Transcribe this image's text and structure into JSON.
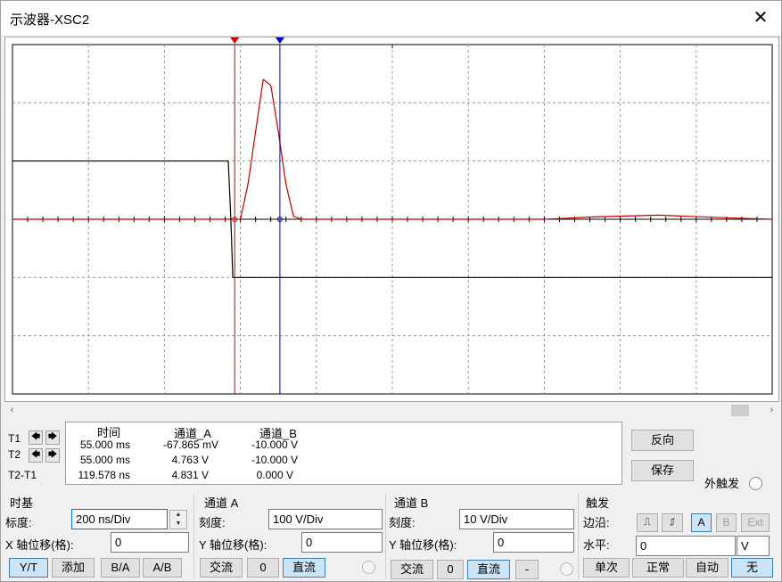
{
  "window": {
    "title": "示波器-XSC2",
    "close_glyph": "✕"
  },
  "cursors": {
    "rows": [
      {
        "label": "T1",
        "time": "55.000 ms",
        "cha": "-67.865 mV",
        "chb": "-10.000 V"
      },
      {
        "label": "T2",
        "time": "55.000 ms",
        "cha": "4.763 V",
        "chb": "-10.000 V"
      },
      {
        "label": "T2-T1",
        "time": "119.578 ns",
        "cha": "4.831 V",
        "chb": "0.000 V"
      }
    ],
    "headers": {
      "time": "时间",
      "cha": "通道_A",
      "chb": "通道_B"
    },
    "left_glyph": "🡄",
    "right_glyph": "🡆"
  },
  "side_buttons": {
    "reverse": "反向",
    "save": "保存",
    "ext_trigger": "外触发"
  },
  "timebase": {
    "title": "时基",
    "scale_label": "标度:",
    "scale_value": "200 ns/Div",
    "xpos_label": "X 轴位移(格):",
    "xpos_value": "0",
    "buttons": [
      "Y/T",
      "添加",
      "B/A",
      "A/B"
    ],
    "selected": "Y/T"
  },
  "channel_a": {
    "title": "通道 A",
    "scale_label": "刻度:",
    "scale_value": "100  V/Div",
    "ypos_label": "Y 轴位移(格):",
    "ypos_value": "0",
    "coupling": [
      "交流",
      "0",
      "直流"
    ],
    "selected": "直流"
  },
  "channel_b": {
    "title": "通道 B",
    "scale_label": "刻度:",
    "scale_value": "10  V/Div",
    "ypos_label": "Y 轴位移(格):",
    "ypos_value": "0",
    "coupling": [
      "交流",
      "0",
      "直流",
      "-"
    ],
    "selected": "直流"
  },
  "trigger": {
    "title": "触发",
    "edge_label": "边沿:",
    "edge_buttons": [
      "⎍",
      "⎎",
      "A",
      "B",
      "Ext"
    ],
    "source_selected": "A",
    "level_label": "水平:",
    "level_value": "0",
    "level_unit": "V",
    "modes": [
      "单次",
      "正常",
      "自动",
      "无"
    ],
    "mode_selected": "无"
  },
  "colors": {
    "channel_a_trace": "#c00000",
    "channel_b_trace": "#000000",
    "cursor_t1": "#d40000",
    "cursor_t2": "#0000c0",
    "grid": "#9a9a9a",
    "selected_button": "#cce4f7"
  },
  "chart_data": {
    "type": "line",
    "title": "",
    "time_per_div_ns": 200,
    "divisions": {
      "x": 10,
      "y": 6
    },
    "x_range_ns": [
      0,
      2000
    ],
    "series": [
      {
        "name": "通道_A",
        "color": "#c00000",
        "volts_per_div": 100,
        "x_ns": [
          0,
          400,
          580,
          585,
          600,
          620,
          640,
          660,
          680,
          700,
          720,
          740,
          760,
          1400,
          1530,
          1700,
          1900,
          2000
        ],
        "y_v": [
          0,
          0,
          0,
          -0.07,
          0,
          60,
          150,
          240,
          230,
          150,
          60,
          5,
          0,
          0,
          4,
          7,
          2,
          0
        ]
      },
      {
        "name": "通道_B",
        "color": "#000000",
        "volts_per_div": 10,
        "x_ns": [
          0,
          568,
          575,
          580,
          2000
        ],
        "y_v": [
          10,
          10,
          0,
          -10,
          -10
        ]
      }
    ],
    "cursors_ns": {
      "T1": 585,
      "T2": 704
    }
  }
}
